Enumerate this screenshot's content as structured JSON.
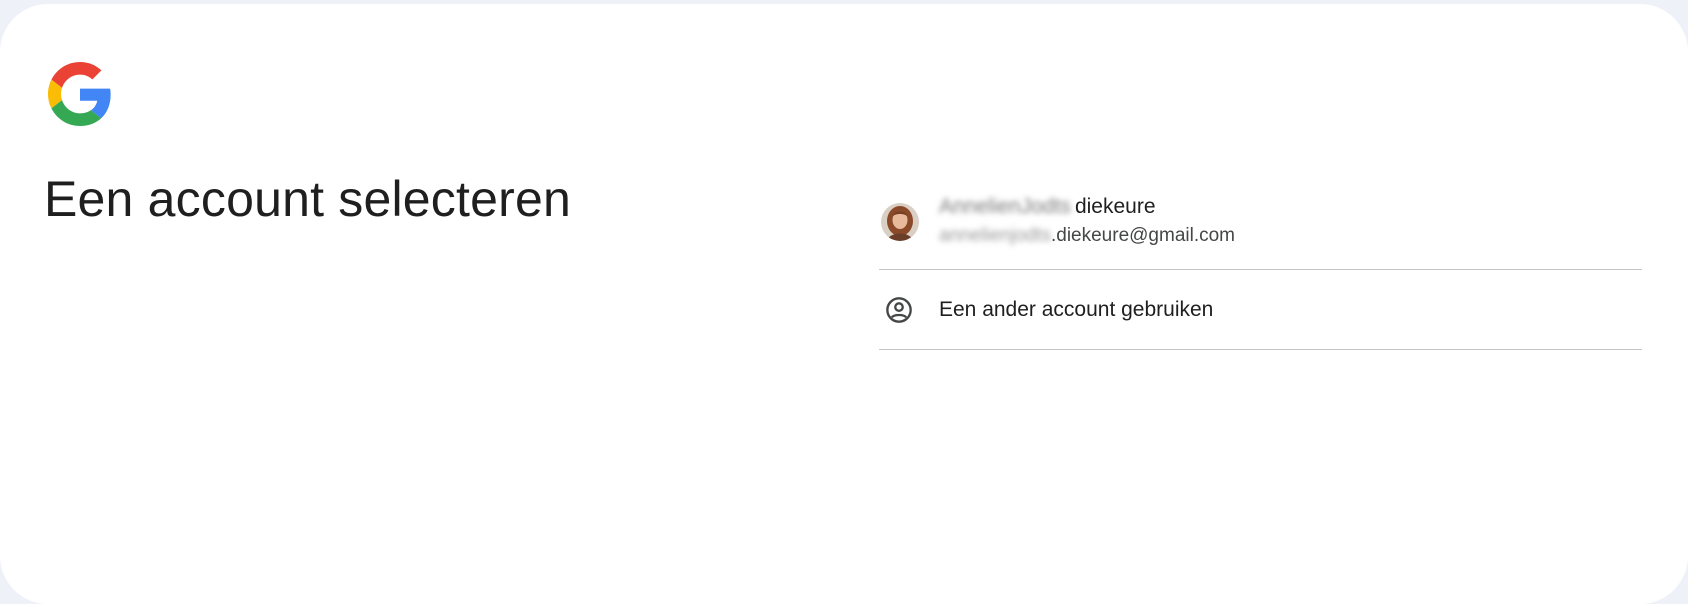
{
  "page": {
    "title": "Een account selecteren"
  },
  "logo": {
    "icon": "google-g-logo",
    "colors": {
      "blue": "#4285F4",
      "red": "#EA4335",
      "yellow": "#FBBC05",
      "green": "#34A853"
    }
  },
  "accounts": [
    {
      "name_visible": "diekeure",
      "name_blurred": "AnnelienJodts",
      "email_visible": ".diekeure@gmail.com",
      "email_blurred": "annelienjodts",
      "avatar": "user-photo-avatar"
    }
  ],
  "other_account": {
    "label": "Een ander account gebruiken",
    "icon": "account-circle-icon"
  }
}
